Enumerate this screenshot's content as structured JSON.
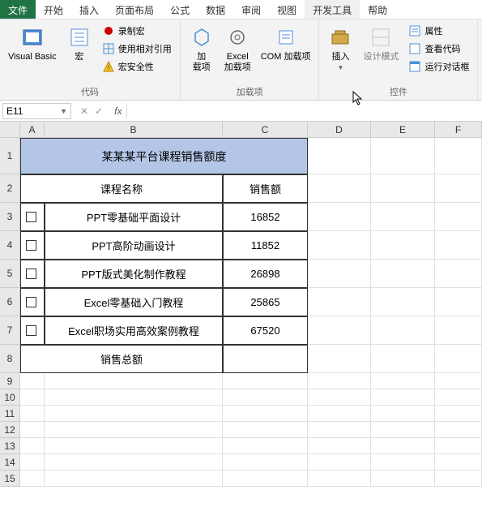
{
  "menu": {
    "file": "文件",
    "tabs": [
      "开始",
      "插入",
      "页面布局",
      "公式",
      "数据",
      "审阅",
      "视图",
      "开发工具",
      "帮助"
    ],
    "active": "开发工具"
  },
  "ribbon": {
    "code": {
      "label": "代码",
      "vb": "Visual Basic",
      "macro": "宏",
      "record": "录制宏",
      "relative": "使用相对引用",
      "security": "宏安全性"
    },
    "addins": {
      "label": "加载项",
      "addin": "加\n载项",
      "excel_addin": "Excel\n加载项",
      "com": "COM 加载项"
    },
    "controls": {
      "label": "控件",
      "insert": "插入",
      "design": "设计模式",
      "properties": "属性",
      "viewcode": "查看代码",
      "rundialog": "运行对话框"
    }
  },
  "namebox": "E11",
  "chart_data": {
    "type": "table",
    "title": "某某某平台课程销售额度",
    "columns": [
      "课程名称",
      "销售额"
    ],
    "rows": [
      {
        "name": "PPT零基础平面设计",
        "value": 16852
      },
      {
        "name": "PPT高阶动画设计",
        "value": 11852
      },
      {
        "name": "PPT版式美化制作教程",
        "value": 26898
      },
      {
        "name": "Excel零基础入门教程",
        "value": 25865
      },
      {
        "name": "Excel职场实用高效案例教程",
        "value": 67520
      }
    ],
    "total_label": "销售总额"
  },
  "cols": [
    "A",
    "B",
    "C",
    "D",
    "E",
    "F"
  ],
  "row_heights": {
    "header": 45,
    "data": 35,
    "blank": 20
  }
}
